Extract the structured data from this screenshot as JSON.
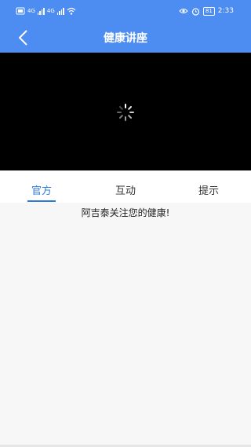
{
  "status_bar": {
    "carrier_1": "4G",
    "carrier_2": "4G",
    "battery_percent": 81,
    "time": "2:33",
    "icons": [
      "sim-icon",
      "signal-icon",
      "signal-icon",
      "wifi-icon",
      "eye-icon",
      "alarm-icon",
      "battery-icon"
    ]
  },
  "header": {
    "title": "健康讲座",
    "back_icon": "chevron-left-icon"
  },
  "video": {
    "state_icon": "loading-spinner-icon",
    "background_color": "#000000"
  },
  "tabs": [
    {
      "label": "官方",
      "active": true
    },
    {
      "label": "互动",
      "active": false
    },
    {
      "label": "提示",
      "active": false
    }
  ],
  "content": {
    "message": "阿吉泰关注您的健康!"
  },
  "colors": {
    "accent": "#4d8cf0",
    "active_tab": "#2e7be0",
    "background": "#f7f7f7"
  }
}
